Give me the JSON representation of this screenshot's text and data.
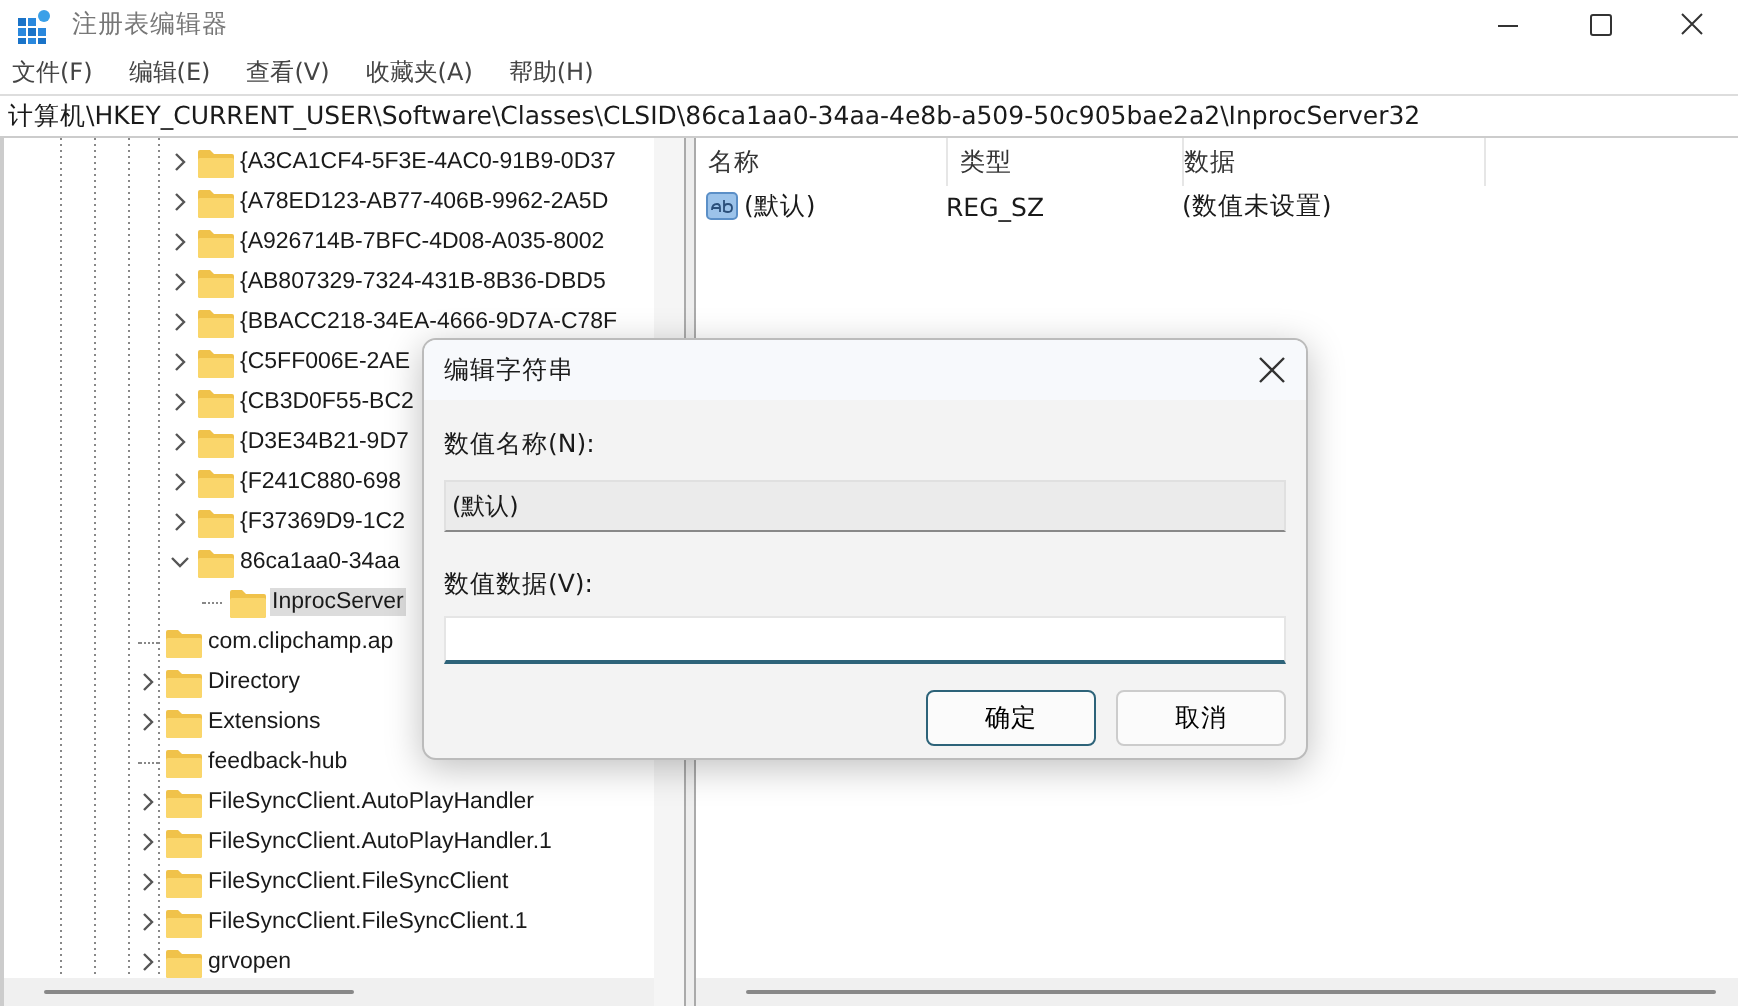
{
  "window": {
    "title": "注册表编辑器"
  },
  "menu": [
    "文件(F)",
    "编辑(E)",
    "查看(V)",
    "收藏夹(A)",
    "帮助(H)"
  ],
  "address": "计算机\\HKEY_CURRENT_USER\\Software\\Classes\\CLSID\\86ca1aa0-34aa-4e8b-a509-50c905bae2a2\\InprocServer32",
  "tree": {
    "continued_children": [
      {
        "label": "{A3CA1CF4-5F3E-4AC0-91B9-0D37",
        "expandable": true,
        "expanded": false,
        "selected": false
      },
      {
        "label": "{A78ED123-AB77-406B-9962-2A5D",
        "expandable": true,
        "expanded": false,
        "selected": false
      },
      {
        "label": "{A926714B-7BFC-4D08-A035-8002",
        "expandable": true,
        "expanded": false,
        "selected": false
      },
      {
        "label": "{AB807329-7324-431B-8B36-DBD5",
        "expandable": true,
        "expanded": false,
        "selected": false
      },
      {
        "label": "{BBACC218-34EA-4666-9D7A-C78F",
        "expandable": true,
        "expanded": false,
        "selected": false
      },
      {
        "label": "{C5FF006E-2AE",
        "expandable": true,
        "expanded": false,
        "selected": false
      },
      {
        "label": "{CB3D0F55-BC2",
        "expandable": true,
        "expanded": false,
        "selected": false
      },
      {
        "label": "{D3E34B21-9D7",
        "expandable": true,
        "expanded": false,
        "selected": false
      },
      {
        "label": "{F241C880-698",
        "expandable": true,
        "expanded": false,
        "selected": false
      },
      {
        "label": "{F37369D9-1C2",
        "expandable": true,
        "expanded": false,
        "selected": false
      },
      {
        "label": "86ca1aa0-34aa",
        "expandable": true,
        "expanded": true,
        "selected": false,
        "children": [
          {
            "label": "InprocServer",
            "expandable": false,
            "expanded": false,
            "selected": true
          }
        ]
      }
    ],
    "items": [
      {
        "label": "com.clipchamp.ap",
        "expandable": false,
        "expanded": false,
        "selected": false
      },
      {
        "label": "Directory",
        "expandable": true,
        "expanded": false,
        "selected": false
      },
      {
        "label": "Extensions",
        "expandable": true,
        "expanded": false,
        "selected": false
      },
      {
        "label": "feedback-hub",
        "expandable": false,
        "expanded": false,
        "selected": false
      },
      {
        "label": "FileSyncClient.AutoPlayHandler",
        "expandable": true,
        "expanded": false,
        "selected": false
      },
      {
        "label": "FileSyncClient.AutoPlayHandler.1",
        "expandable": true,
        "expanded": false,
        "selected": false
      },
      {
        "label": "FileSyncClient.FileSyncClient",
        "expandable": true,
        "expanded": false,
        "selected": false
      },
      {
        "label": "FileSyncClient.FileSyncClient.1",
        "expandable": true,
        "expanded": false,
        "selected": false
      },
      {
        "label": "grvopen",
        "expandable": true,
        "expanded": false,
        "selected": false
      }
    ]
  },
  "values": {
    "columns": [
      "名称",
      "类型",
      "数据"
    ],
    "rows": [
      {
        "name": "(默认)",
        "type": "REG_SZ",
        "data": "(数值未设置)"
      }
    ]
  },
  "dialog": {
    "title": "编辑字符串",
    "name_label": "数值名称(N):",
    "name_value": "(默认)",
    "data_label": "数值数据(V):",
    "buttons": [
      {
        "label": "确定",
        "default": true
      },
      {
        "label": "取消",
        "default": false
      }
    ]
  }
}
